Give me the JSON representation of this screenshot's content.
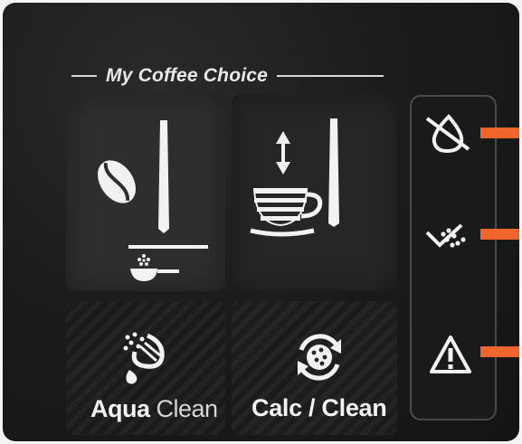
{
  "header": {
    "title": "My Coffee Choice"
  },
  "buttons": {
    "aqua_clean": {
      "label_bold": "Aqua",
      "label_thin": "Clean"
    },
    "calc_clean": {
      "label": "Calc / Clean"
    }
  },
  "icons": {
    "strength": "coffee-bean-icon",
    "ground": "measuring-scoop-icon",
    "volume": "cup-volume-icon",
    "aqua": "water-filter-icon",
    "calc": "descale-cycle-icon",
    "no_water": "water-off-icon",
    "grounds": "grounds-container-icon",
    "warning": "warning-icon"
  },
  "colors": {
    "indicator": "#f0652c",
    "panel": "#1c1c1c",
    "symbol": "#f2f2f2"
  }
}
